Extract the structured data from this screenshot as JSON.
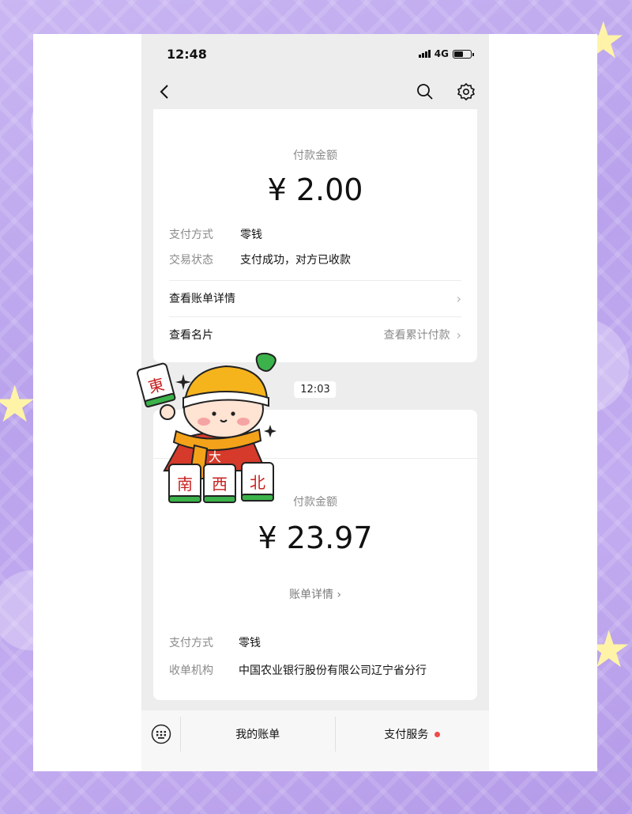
{
  "status_bar": {
    "time": "12:48",
    "network": "4G"
  },
  "nav": {
    "back_icon": "back-chevron-icon",
    "search_icon": "search-icon",
    "settings_icon": "gear-icon"
  },
  "messages": [
    {
      "pay_label": "付款金额",
      "amount": "¥ 2.00",
      "details": [
        {
          "key": "支付方式",
          "value": "零钱"
        },
        {
          "key": "交易状态",
          "value": "支付成功，对方已收款"
        }
      ],
      "links": [
        {
          "label": "查看账单详情",
          "right": ""
        },
        {
          "label": "查看名片",
          "right": "查看累计付款"
        }
      ]
    },
    {
      "timestamp": "12:03",
      "pay_label": "付款金额",
      "amount": "¥ 23.97",
      "bill_detail": "账单详情 ›",
      "details": [
        {
          "key": "支付方式",
          "value": "零钱"
        },
        {
          "key": "收单机构",
          "value": "中国农业银行股份有限公司辽宁省分行"
        }
      ]
    }
  ],
  "bottom_bar": {
    "keyboard_icon": "keyboard-icon",
    "items": [
      {
        "label": "我的账单"
      },
      {
        "label": "支付服务",
        "has_dot": true
      }
    ]
  },
  "sticker": {
    "tiles": [
      "東",
      "南",
      "西",
      "北"
    ],
    "shirt_char": "大"
  },
  "colors": {
    "accent_dot": "#f04a4a",
    "coin": "#f5c430",
    "background": "#c3acf0"
  }
}
